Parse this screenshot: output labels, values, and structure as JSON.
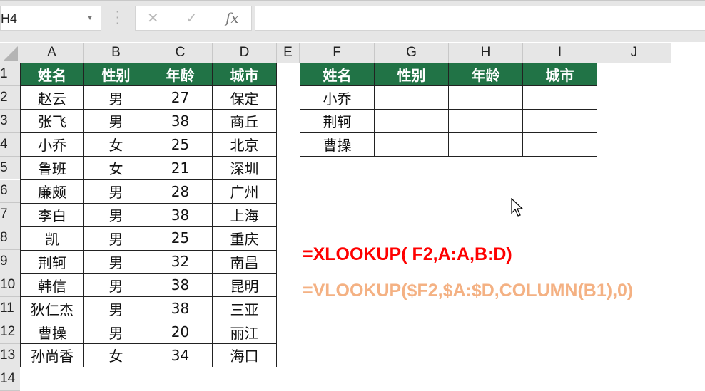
{
  "name_box": {
    "value": "H4"
  },
  "formula_bar": {
    "cancel_icon": "✕",
    "enter_icon": "✓",
    "fx_label": "fx",
    "value": ""
  },
  "columns": [
    "A",
    "B",
    "C",
    "D",
    "E",
    "F",
    "G",
    "H",
    "I",
    "J"
  ],
  "rows": [
    "1",
    "2",
    "3",
    "4",
    "5",
    "6",
    "7",
    "8",
    "9",
    "10",
    "11",
    "12",
    "13",
    "14"
  ],
  "source_table": {
    "headers": [
      "姓名",
      "性别",
      "年龄",
      "城市"
    ],
    "rows": [
      [
        "赵云",
        "男",
        "27",
        "保定"
      ],
      [
        "张飞",
        "男",
        "38",
        "商丘"
      ],
      [
        "小乔",
        "女",
        "25",
        "北京"
      ],
      [
        "鲁班",
        "女",
        "21",
        "深圳"
      ],
      [
        "廉颇",
        "男",
        "28",
        "广州"
      ],
      [
        "李白",
        "男",
        "38",
        "上海"
      ],
      [
        "凯",
        "男",
        "25",
        "重庆"
      ],
      [
        "荆轲",
        "男",
        "32",
        "南昌"
      ],
      [
        "韩信",
        "男",
        "38",
        "昆明"
      ],
      [
        "狄仁杰",
        "男",
        "38",
        "三亚"
      ],
      [
        "曹操",
        "男",
        "20",
        "丽江"
      ],
      [
        "孙尚香",
        "女",
        "34",
        "海口"
      ]
    ]
  },
  "lookup_table": {
    "headers": [
      "姓名",
      "性别",
      "年龄",
      "城市"
    ],
    "rows": [
      [
        "小乔",
        "",
        "",
        ""
      ],
      [
        "荆轲",
        "",
        "",
        ""
      ],
      [
        "曹操",
        "",
        "",
        ""
      ]
    ]
  },
  "formulas": {
    "xlookup": "=XLOOKUP( F2,A:A,B:D)",
    "vlookup": "=VLOOKUP($F2,$A:$D,COLUMN(B1),0)"
  },
  "colors": {
    "header_green": "#217346",
    "xlookup_red": "#ff0000",
    "vlookup_orange": "#f4b183"
  }
}
